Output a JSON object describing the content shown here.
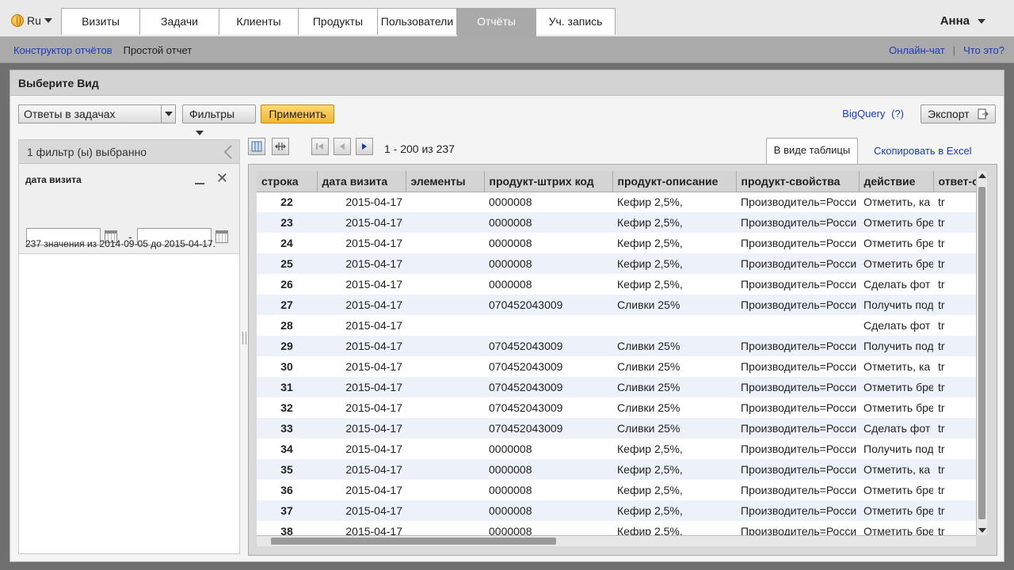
{
  "lang": "Ru",
  "tabs": [
    {
      "label": "Визиты"
    },
    {
      "label": "Задачи"
    },
    {
      "label": "Клиенты"
    },
    {
      "label": "Продукты"
    },
    {
      "label": "Пользователи"
    },
    {
      "label": "Отчёты",
      "active": true
    },
    {
      "label": "Уч. запись"
    }
  ],
  "user": "Анна",
  "subnav": {
    "builder": "Конструктор отчётов",
    "simple": "Простой отчет",
    "chat": "Онлайн-чат",
    "separator": "|",
    "whatis": "Что это?"
  },
  "view": {
    "heading": "Выберите Вид",
    "select_value": "Ответы в задачах",
    "filters_btn": "Фильтры",
    "apply_btn": "Применить",
    "bigquery": "BigQuery",
    "bigquery_help": "(?)",
    "export_btn": "Экспорт"
  },
  "filter_panel": {
    "header": "1 фильтр (ы) выбранно",
    "filter_title": "дата визита",
    "dash": "-",
    "info": "237 значения из 2014-09-05 до 2015-04-17."
  },
  "pager": {
    "info": "1 - 200 из 237",
    "tab_table": "В виде таблицы",
    "copy_excel": "Скопировать в Excel"
  },
  "table": {
    "headers": [
      "строка",
      "дата визита",
      "элементы",
      "продукт-штрих код",
      "продукт-описание",
      "продукт-свойства",
      "действие",
      "ответ-о"
    ],
    "rows": [
      [
        "22",
        "2015-04-17",
        "",
        "0000008",
        "Кефир 2,5%,",
        "Производитель=Росси",
        "Отметить, ка",
        "tr"
      ],
      [
        "23",
        "2015-04-17",
        "",
        "0000008",
        "Кефир 2,5%,",
        "Производитель=Росси",
        "Отметить бре",
        "tr"
      ],
      [
        "24",
        "2015-04-17",
        "",
        "0000008",
        "Кефир 2,5%,",
        "Производитель=Росси",
        "Отметить бре",
        "tr"
      ],
      [
        "25",
        "2015-04-17",
        "",
        "0000008",
        "Кефир 2,5%,",
        "Производитель=Росси",
        "Отметить бре",
        "tr"
      ],
      [
        "26",
        "2015-04-17",
        "",
        "0000008",
        "Кефир 2,5%,",
        "Производитель=Росси",
        "Сделать фот",
        "tr"
      ],
      [
        "27",
        "2015-04-17",
        "",
        "070452043009",
        "Сливки 25%",
        "Производитель=Росси",
        "Получить под",
        "tr"
      ],
      [
        "28",
        "2015-04-17",
        "",
        "",
        "",
        "",
        "Сделать фот",
        "tr"
      ],
      [
        "29",
        "2015-04-17",
        "",
        "070452043009",
        "Сливки 25%",
        "Производитель=Росси",
        "Получить под",
        "tr"
      ],
      [
        "30",
        "2015-04-17",
        "",
        "070452043009",
        "Сливки 25%",
        "Производитель=Росси",
        "Отметить, ка",
        "tr"
      ],
      [
        "31",
        "2015-04-17",
        "",
        "070452043009",
        "Сливки 25%",
        "Производитель=Росси",
        "Отметить бре",
        "tr"
      ],
      [
        "32",
        "2015-04-17",
        "",
        "070452043009",
        "Сливки 25%",
        "Производитель=Росси",
        "Отметить бре",
        "tr"
      ],
      [
        "33",
        "2015-04-17",
        "",
        "070452043009",
        "Сливки 25%",
        "Производитель=Росси",
        "Сделать фот",
        "tr"
      ],
      [
        "34",
        "2015-04-17",
        "",
        "0000008",
        "Кефир 2,5%,",
        "Производитель=Росси",
        "Получить под",
        "tr"
      ],
      [
        "35",
        "2015-04-17",
        "",
        "0000008",
        "Кефир 2,5%,",
        "Производитель=Росси",
        "Отметить, ка",
        "tr"
      ],
      [
        "36",
        "2015-04-17",
        "",
        "0000008",
        "Кефир 2,5%,",
        "Производитель=Росси",
        "Отметить бре",
        "tr"
      ],
      [
        "37",
        "2015-04-17",
        "",
        "0000008",
        "Кефир 2,5%,",
        "Производитель=Росси",
        "Отметить бре",
        "tr"
      ],
      [
        "38",
        "2015-04-17",
        "",
        "0000008",
        "Кефир 2,5%,",
        "Производитель=Росси",
        "Отметить бре",
        "tr"
      ]
    ]
  }
}
